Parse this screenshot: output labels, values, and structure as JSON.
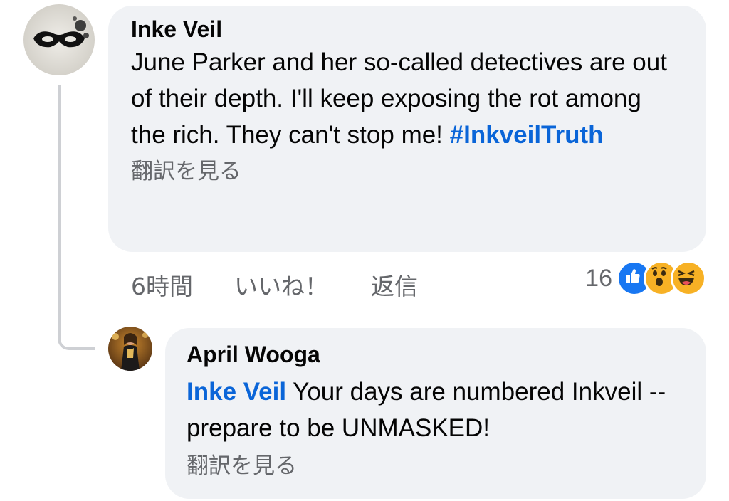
{
  "comment": {
    "author": "Inke Veil",
    "text_before": "June Parker and her so-called detectives are out of their depth. I'll keep exposing the rot among the rich. They can't stop me! ",
    "hashtag": "#InkveilTruth",
    "translate": "翻訳を見る",
    "time": "6時間",
    "like": "いいね！",
    "reply": "返信",
    "reaction_count": "16",
    "reactions": [
      "like-icon",
      "wow-icon",
      "haha-icon"
    ]
  },
  "reply": {
    "author": "April Wooga",
    "mention": "Inke Veil",
    "text": " Your days are numbered Inkveil -- prepare to be UNMASKED!",
    "translate": "翻訳を見る"
  },
  "colors": {
    "bubble": "#f0f2f5",
    "link": "#0a65d8",
    "secondary": "#65676b",
    "like_blue": "#1877f2",
    "emoji_yellow": "#f7b125"
  }
}
